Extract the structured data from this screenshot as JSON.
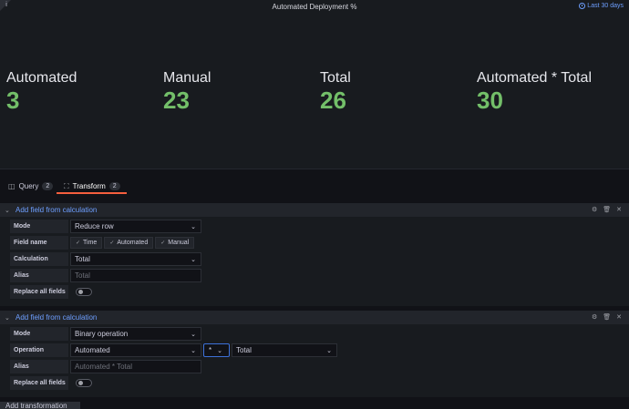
{
  "panel": {
    "title": "Automated Deployment %",
    "time_range": "Last 30 days",
    "stats": [
      {
        "label": "Automated",
        "value": "3"
      },
      {
        "label": "Manual",
        "value": "23"
      },
      {
        "label": "Total",
        "value": "26"
      },
      {
        "label": "Automated * Total",
        "value": "30"
      }
    ],
    "colors": {
      "value": "#73bf69",
      "background": "#181b1f"
    }
  },
  "tabs": [
    {
      "label": "Query",
      "count": "2",
      "icon": "database-icon"
    },
    {
      "label": "Transform",
      "count": "2",
      "icon": "transform-icon",
      "active": true
    }
  ],
  "transformations": [
    {
      "title": "Add field from calculation",
      "mode_label": "Mode",
      "mode_value": "Reduce row",
      "field_name_label": "Field name",
      "field_names": [
        "Time",
        "Automated",
        "Manual"
      ],
      "calculation_label": "Calculation",
      "calculation_value": "Total",
      "alias_label": "Alias",
      "alias_placeholder": "Total",
      "replace_label": "Replace all fields"
    },
    {
      "title": "Add field from calculation",
      "mode_label": "Mode",
      "mode_value": "Binary operation",
      "operation_label": "Operation",
      "operation_left": "Automated",
      "operator": "*",
      "operation_right": "Total",
      "alias_label": "Alias",
      "alias_placeholder": "Automated * Total",
      "replace_label": "Replace all fields"
    }
  ],
  "add_transformation_label": "Add transformation"
}
